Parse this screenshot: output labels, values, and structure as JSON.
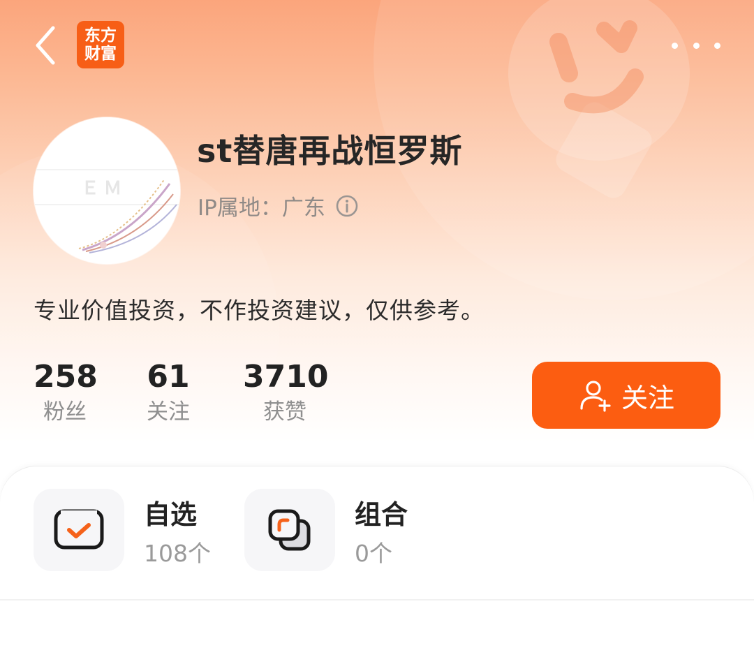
{
  "header": {
    "logo_line1": "东方",
    "logo_line2": "财富"
  },
  "profile": {
    "username": "st替唐再战恒罗斯",
    "ip_location": "IP属地：广东",
    "bio": "专业价值投资，不作投资建议，仅供参考。"
  },
  "stats": [
    {
      "value": "258",
      "label": "粉丝"
    },
    {
      "value": "61",
      "label": "关注"
    },
    {
      "value": "3710",
      "label": "获赞"
    }
  ],
  "follow_button": {
    "label": "关注",
    "icon": "add-user-icon",
    "color": "#fc5d11"
  },
  "tiles": [
    {
      "title": "自选",
      "subtitle": "108个",
      "icon": "watchlist-check-icon"
    },
    {
      "title": "组合",
      "subtitle": "0个",
      "icon": "portfolio-icon"
    }
  ],
  "colors": {
    "accent": "#fc5d11",
    "logo": "#f75e16"
  }
}
